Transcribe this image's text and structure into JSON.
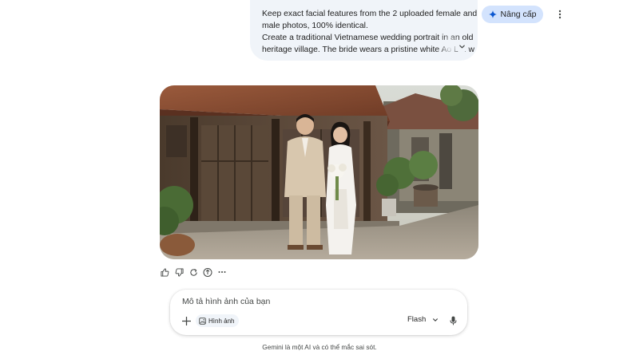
{
  "colors": {
    "bubble_bg": "#f0f4f9",
    "upgrade_bg": "#d3e3fd",
    "icon": "#444746",
    "text": "#1f1f1f",
    "accent": "#0b57d0"
  },
  "user_message": {
    "lines": [
      "Keep exact facial features from the 2 uploaded female and",
      "male photos, 100% identical.",
      "Create a traditional Vietnamese wedding portrait in an old",
      "heritage village. The bride wears a pristine white Ao Dai w"
    ],
    "expand_icon": "chevron-down-icon"
  },
  "header": {
    "upgrade_label": "Nâng cấp",
    "upgrade_icon": "sparkle-icon",
    "menu_icon": "more-vert-icon"
  },
  "response": {
    "image_alt": "Vietnamese wedding portrait in old heritage village",
    "actions": [
      "thumb-up-icon",
      "thumb-down-icon",
      "refresh-icon",
      "share-icon",
      "more-horiz-icon"
    ]
  },
  "prompt": {
    "placeholder": "Mô tả hình ảnh của bạn",
    "chip_label": "Hình ảnh",
    "model_label": "Flash"
  },
  "footer": {
    "disclaimer": "Gemini là một AI và có thể mắc sai sót."
  }
}
